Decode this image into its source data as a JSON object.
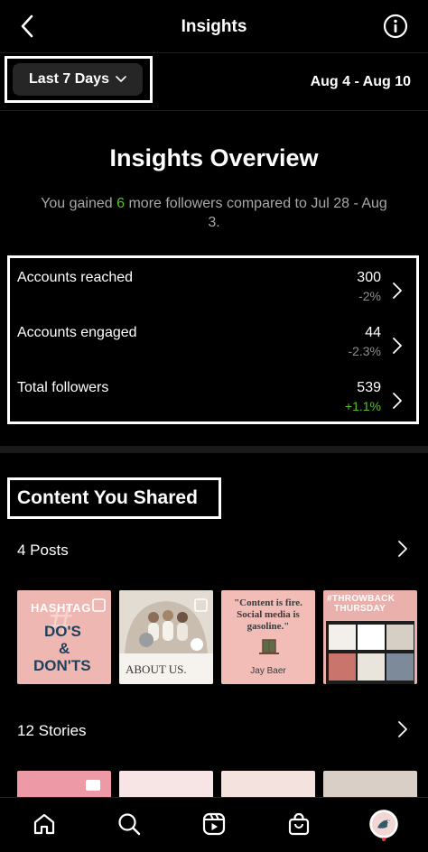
{
  "header": {
    "title": "Insights",
    "back_icon": "chevron-left-icon",
    "info_icon": "info-icon"
  },
  "filter": {
    "range_label": "Last 7 Days",
    "date_range": "Aug 4 - Aug 10"
  },
  "overview": {
    "title": "Insights Overview",
    "subtitle_prefix": "You gained ",
    "gained_count": "6",
    "subtitle_suffix": " more followers compared to Jul 28 - Aug 3."
  },
  "metrics": [
    {
      "label": "Accounts reached",
      "value": "300",
      "change": "-2%"
    },
    {
      "label": "Accounts engaged",
      "value": "44",
      "change": "-2.3%"
    },
    {
      "label": "Total followers",
      "value": "539",
      "change": "+1.1%"
    }
  ],
  "content": {
    "section_title": "Content You Shared",
    "posts_label": "4 Posts",
    "stories_label": "12 Stories",
    "posts": [
      {
        "line1": "HASHTAG",
        "line2": "DO'S",
        "line3": "&",
        "line4": "DON'TS"
      },
      {
        "caption": "ABOUT US."
      },
      {
        "quote": "\"Content is fire. Social media is gasoline.\"",
        "author": "Jay Baer"
      },
      {
        "line1": "#THROWBACK",
        "line2": "THURSDAY"
      }
    ]
  },
  "colors": {
    "accent_green": "#58c322",
    "pink": "#f2b9b5",
    "background": "#000000"
  },
  "tabbar": [
    "home-icon",
    "search-icon",
    "reels-icon",
    "shop-icon",
    "profile-avatar"
  ]
}
